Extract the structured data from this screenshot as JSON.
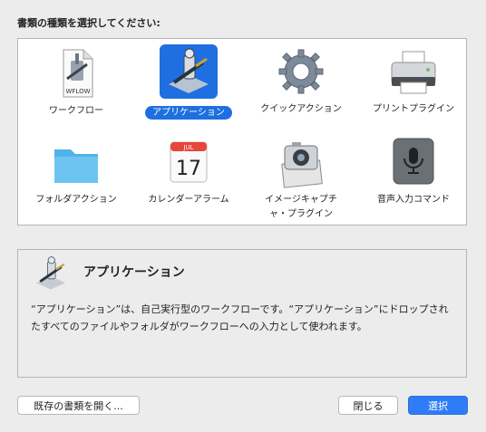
{
  "dialog": {
    "heading": "書類の種類を選択してください:"
  },
  "document_types": [
    {
      "label": "ワークフロー",
      "icon": "workflow-icon",
      "icon_text": "WFLOW",
      "selected": false
    },
    {
      "label": "アプリケーション",
      "icon": "automator-app-icon",
      "selected": true
    },
    {
      "label": "クイックアクション",
      "icon": "gear-icon",
      "selected": false
    },
    {
      "label": "プリントプラグイン",
      "icon": "printer-icon",
      "selected": false
    },
    {
      "label": "フォルダアクション",
      "icon": "folder-icon",
      "selected": false
    },
    {
      "label": "カレンダーアラーム",
      "icon": "calendar-icon",
      "icon_month": "JUL",
      "icon_day": "17",
      "selected": false
    },
    {
      "label": "イメージキャプチャ・プラグイン",
      "label_line1": "イメージキャプチ",
      "label_line2": "ャ・プラグイン",
      "icon": "camera-icon",
      "selected": false
    },
    {
      "label": "音声入力コマンド",
      "icon": "microphone-icon",
      "selected": false
    }
  ],
  "description": {
    "title": "アプリケーション",
    "body": "“アプリケーション”は、自己実行型のワークフローです。“アプリケーション”にドロップされたすべてのファイルやフォルダがワークフローへの入力として使われます。"
  },
  "buttons": {
    "open_existing": "既存の書類を開く...",
    "close": "閉じる",
    "choose": "選択"
  },
  "colors": {
    "accent": "#1f6fe0",
    "primary_button": "#2e7cf6",
    "background": "#ececec"
  }
}
